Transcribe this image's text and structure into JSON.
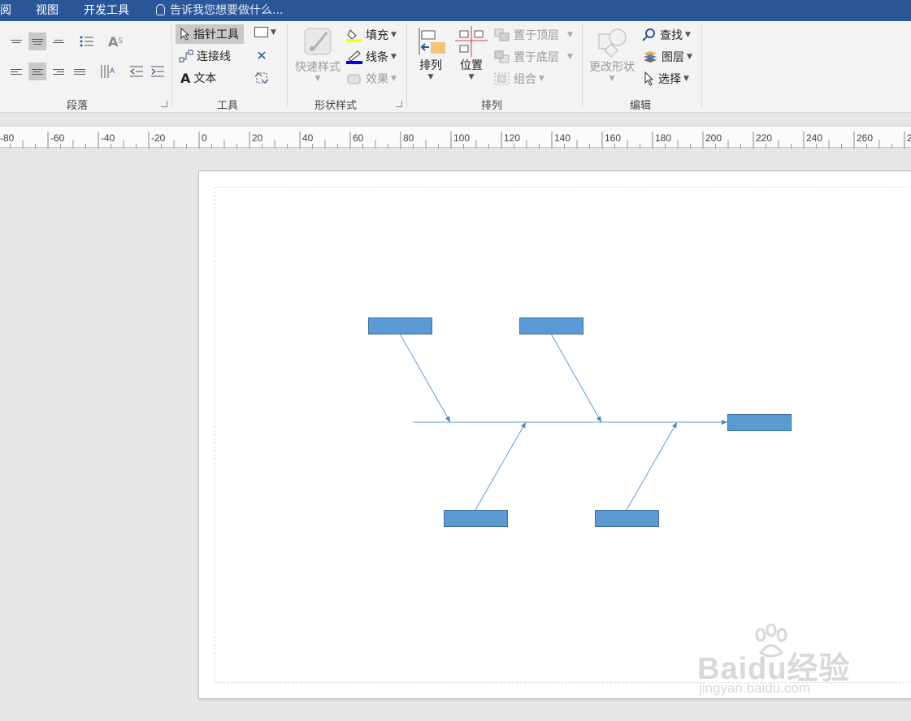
{
  "menu": {
    "items": [
      "阅",
      "视图",
      "开发工具"
    ],
    "tell_me": "告诉我您想要做什么..."
  },
  "ribbon": {
    "groups": {
      "paragraph": "段落",
      "tools": "工具",
      "shape_styles": "形状样式",
      "arrange": "排列",
      "edit": "编辑"
    },
    "tools": {
      "pointer": "指针工具",
      "connector": "连接线",
      "text": "文本"
    },
    "shape_styles": {
      "quick_styles": "快速样式",
      "fill": "填充",
      "line": "线条",
      "effects": "效果"
    },
    "arrange": {
      "align": "排列",
      "position": "位置",
      "bring_front": "置于顶层",
      "send_back": "置于底层",
      "group": "组合"
    },
    "edit": {
      "change_shape": "更改形状",
      "find": "查找",
      "layers": "图层",
      "select": "选择"
    }
  },
  "ruler": {
    "labels": [
      "-80",
      "-60",
      "-40",
      "-20",
      "0",
      "20",
      "40",
      "60",
      "80",
      "100",
      "120",
      "140",
      "160",
      "180",
      "200",
      "220",
      "240",
      "260",
      "2"
    ]
  },
  "watermark": {
    "brand": "Baidu经验",
    "url": "jingyan.baidu.com"
  },
  "colors": {
    "menu_bg": "#2b579a",
    "shape_fill": "#5b9bd5",
    "shape_border": "#41719c",
    "connector": "#5b9bd5"
  }
}
